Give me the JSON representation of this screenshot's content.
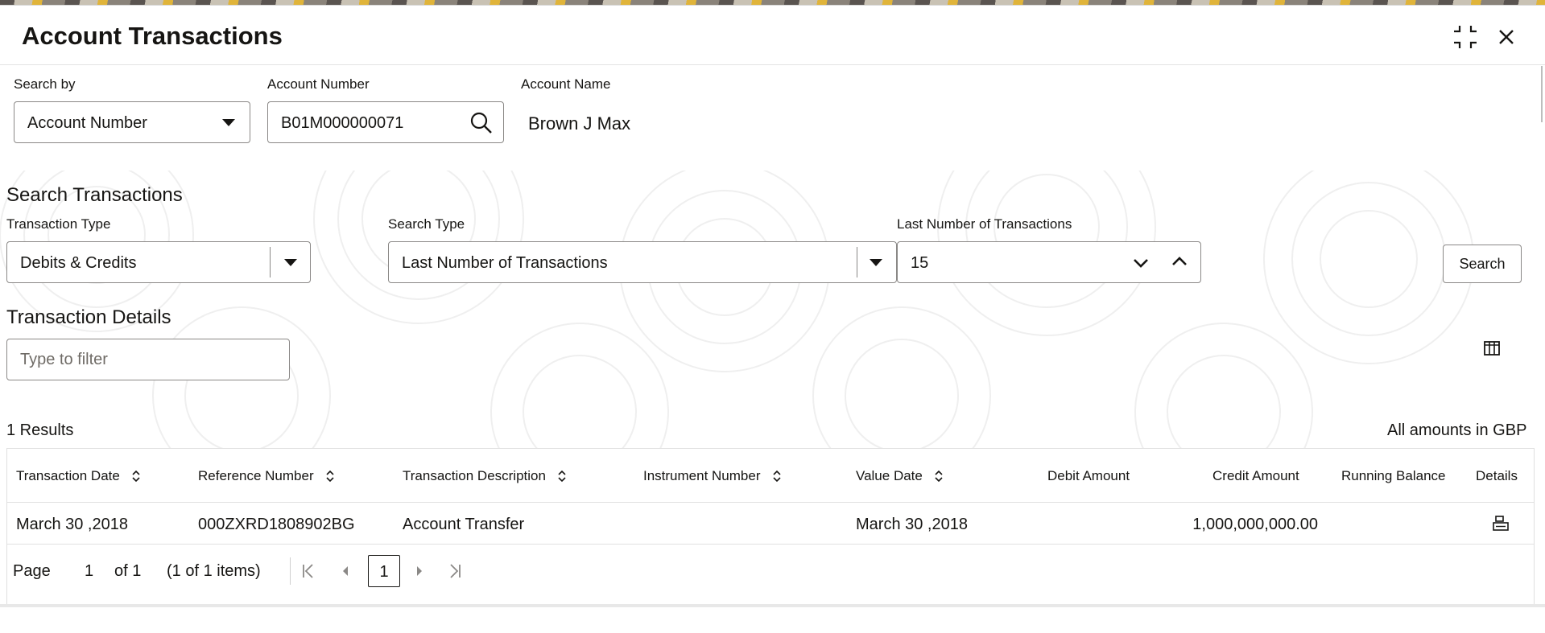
{
  "dialog": {
    "title": "Account Transactions"
  },
  "account": {
    "search_by_label": "Search by",
    "search_by_value": "Account Number",
    "account_number_label": "Account Number",
    "account_number_value": "B01M000000071",
    "account_name_label": "Account Name",
    "account_name_value": "Brown J Max"
  },
  "search": {
    "section_title": "Search Transactions",
    "transaction_type_label": "Transaction Type",
    "transaction_type_value": "Debits & Credits",
    "search_type_label": "Search Type",
    "search_type_value": "Last Number of Transactions",
    "last_number_label": "Last Number of Transactions",
    "last_number_value": "15",
    "search_button": "Search"
  },
  "details": {
    "section_title": "Transaction Details",
    "filter_placeholder": "Type to filter",
    "results_count": "1 Results",
    "currency_note": "All amounts in GBP"
  },
  "table": {
    "columns": [
      "Transaction Date",
      "Reference Number",
      "Transaction Description",
      "Instrument Number",
      "Value Date",
      "Debit Amount",
      "Credit Amount",
      "Running Balance",
      "Details"
    ],
    "rows": [
      {
        "transaction_date": "March 30 ,2018",
        "reference_number": "000ZXRD1808902BG",
        "description": "Account Transfer",
        "instrument_number": "",
        "value_date": "March 30 ,2018",
        "debit_amount": "",
        "credit_amount": "1,000,000,000.00",
        "running_balance": ""
      }
    ]
  },
  "pagination": {
    "page_label": "Page",
    "page_value": "1",
    "of_label": "of 1",
    "items_label": "(1 of 1 items)",
    "current_page": "1"
  }
}
